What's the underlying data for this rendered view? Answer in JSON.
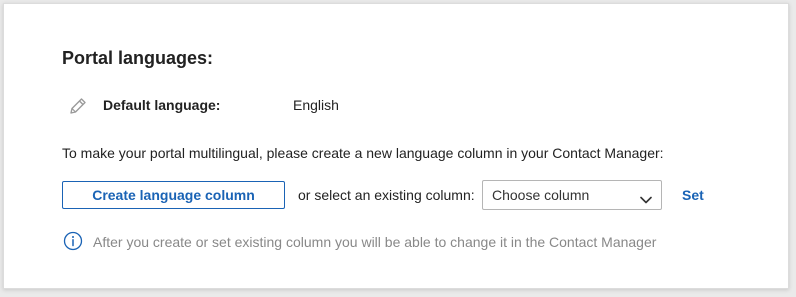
{
  "section": {
    "title": "Portal languages:"
  },
  "default_language": {
    "icon": "pencil-icon",
    "label": "Default language:",
    "value": "English"
  },
  "instruction": "To make your portal multilingual, please create a new language column in your Contact Manager:",
  "actions": {
    "create_button_label": "Create language column",
    "or_text": "or select an existing column:",
    "select_value": "Choose column",
    "set_label": "Set"
  },
  "info": {
    "icon": "info-icon",
    "text": "After you create or set existing column you will be able to change it in the Contact Manager"
  },
  "colors": {
    "accent": "#1a63b5",
    "muted_text": "#888888",
    "icon_gray": "#9a9a9a"
  }
}
